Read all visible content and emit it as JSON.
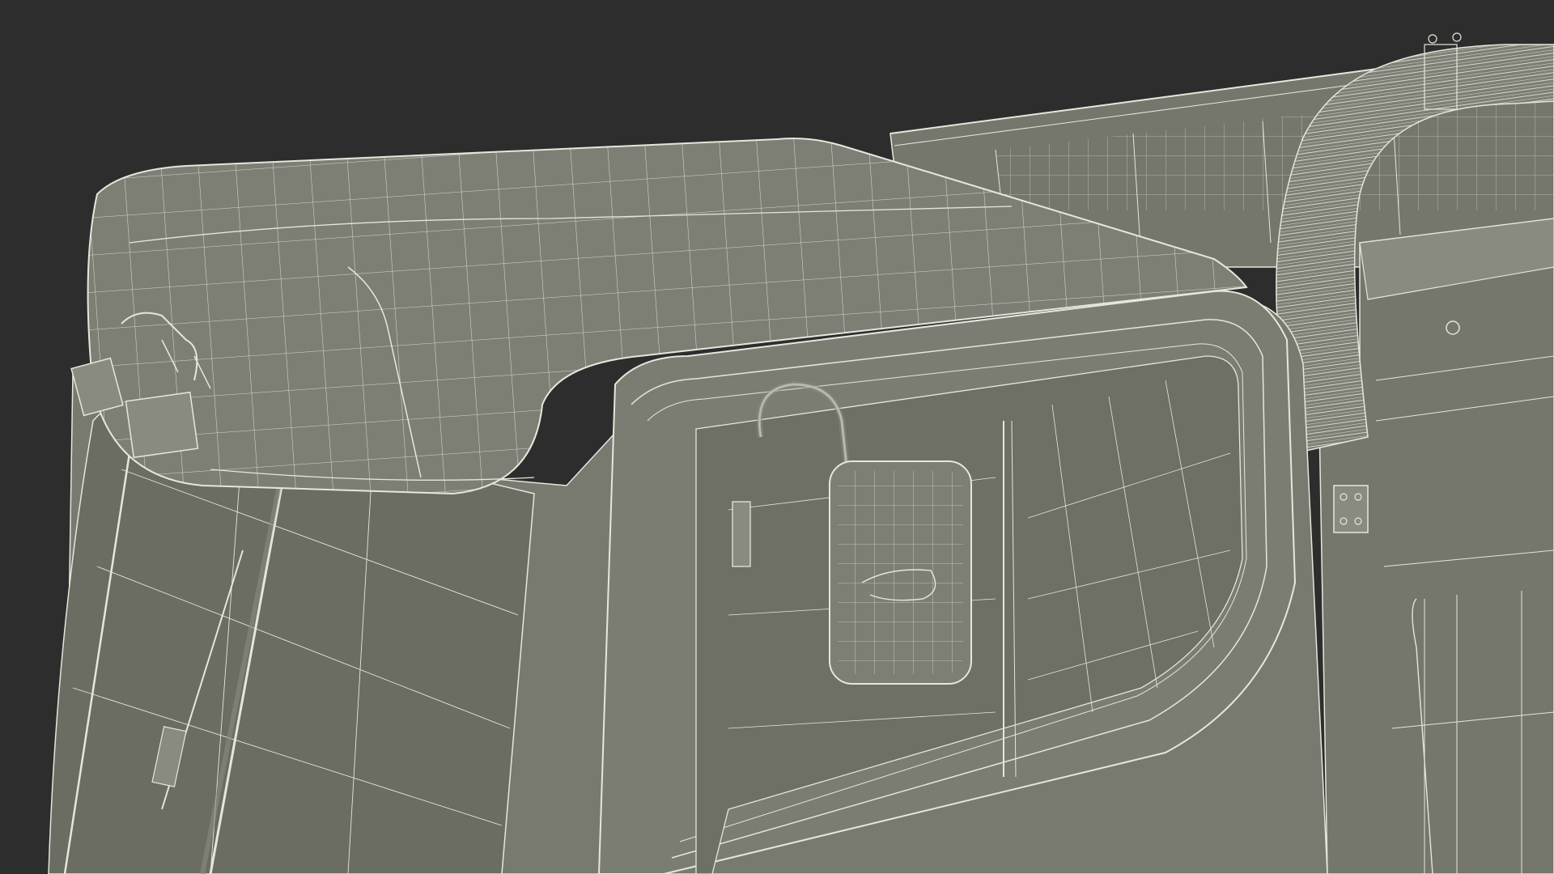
{
  "scene": {
    "subject": "cab-wireframe-render",
    "colors": {
      "background": "#2d2d2d",
      "surface": "#7a7b70",
      "surface_dark": "#66675d",
      "surface_light": "#8a8b80",
      "wire": "#e6e6dc",
      "wire_dim": "#c9c9bd",
      "edge": "#3a3a34"
    },
    "parts": [
      "roof-panel",
      "cab-body",
      "windshield",
      "wiper-arm",
      "side-window",
      "door-frame",
      "side-mirror",
      "mirror-bracket",
      "work-light",
      "rear-deck",
      "exhaust-hose",
      "side-cabinet",
      "hinge-plate",
      "handle-rail"
    ]
  }
}
